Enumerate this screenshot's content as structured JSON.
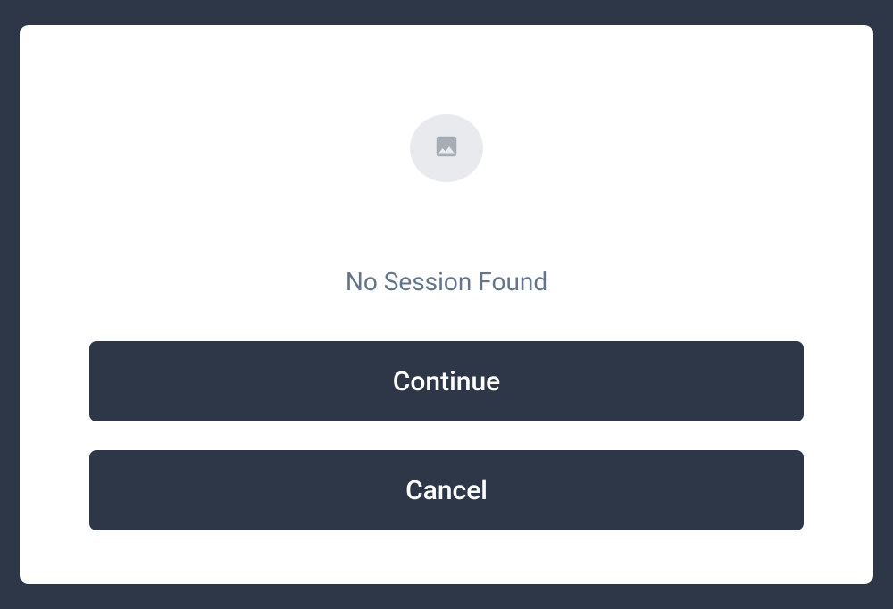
{
  "dialog": {
    "icon": "image-placeholder-icon",
    "message": "No Session Found",
    "buttons": {
      "continue_label": "Continue",
      "cancel_label": "Cancel"
    }
  }
}
